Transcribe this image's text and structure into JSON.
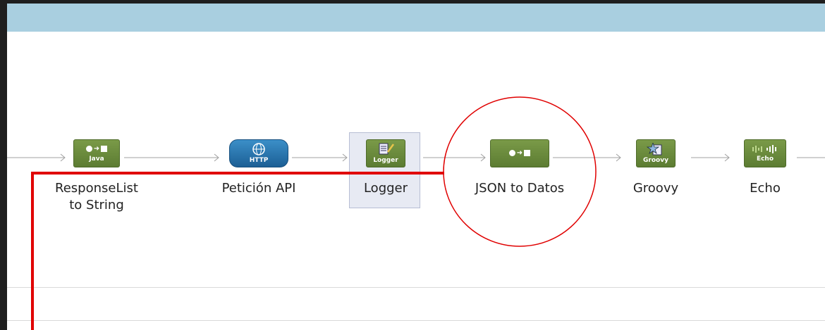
{
  "flow": {
    "nodes": [
      {
        "icon_label": "Java",
        "label_line1": "ResponseList",
        "label_line2": "to String"
      },
      {
        "icon_label": "HTTP",
        "label_line1": "Petición API"
      },
      {
        "icon_label": "Logger",
        "label_line1": "Logger"
      },
      {
        "icon_label": "",
        "label_line1": "JSON to Datos"
      },
      {
        "icon_label": "Groovy",
        "label_line1": "Groovy"
      },
      {
        "icon_label": "Echo",
        "label_line1": "Echo"
      }
    ]
  },
  "icons": {
    "transformer": "circle-arrow-square-icon",
    "http": "globe-icon",
    "logger": "document-pencil-icon",
    "groovy": "star-document-icon",
    "echo": "sound-wave-icon"
  },
  "annotations": {
    "highlight_color": "#e00000",
    "highlighted_node": "JSON to Datos"
  },
  "colors": {
    "header_bar": "#a9cfe0",
    "node_green": "#6b8b3c",
    "node_http": "#2a78b5"
  }
}
